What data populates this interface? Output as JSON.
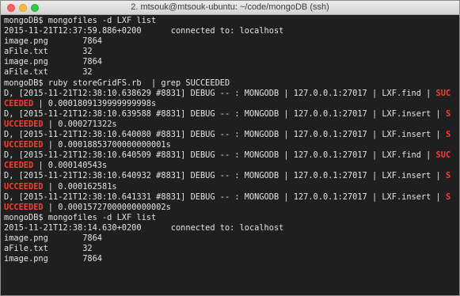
{
  "window": {
    "title": "2. mtsouk@mtsouk-ubuntu: ~/code/mongoDB (ssh)"
  },
  "colors": {
    "background": "#1f1f1f",
    "text": "#e4e4e4",
    "grep_highlight": "#ff3b30"
  },
  "terminal": {
    "lines": [
      {
        "segments": [
          {
            "text": "mongoDB$ mongofiles -d LXF list",
            "hl": false
          }
        ]
      },
      {
        "segments": [
          {
            "text": "2015-11-21T12:37:59.886+0200      connected to: localhost",
            "hl": false
          }
        ]
      },
      {
        "segments": [
          {
            "text": "image.png       7864",
            "hl": false
          }
        ]
      },
      {
        "segments": [
          {
            "text": "aFile.txt       32",
            "hl": false
          }
        ]
      },
      {
        "segments": [
          {
            "text": "image.png       7864",
            "hl": false
          }
        ]
      },
      {
        "segments": [
          {
            "text": "aFile.txt       32",
            "hl": false
          }
        ]
      },
      {
        "segments": [
          {
            "text": "mongoDB$ ruby storeGridFS.rb  | grep SUCCEEDED",
            "hl": false
          }
        ]
      },
      {
        "segments": [
          {
            "text": "D, [2015-11-21T12:38:10.638629 #8831] DEBUG -- : MONGODB | 127.0.0.1:27017 | LXF.find | ",
            "hl": false
          },
          {
            "text": "SUC",
            "hl": true
          }
        ]
      },
      {
        "segments": [
          {
            "text": "CEEDED",
            "hl": true
          },
          {
            "text": " | 0.0001809139999999998s",
            "hl": false
          }
        ]
      },
      {
        "segments": [
          {
            "text": "D, [2015-11-21T12:38:10.639588 #8831] DEBUG -- : MONGODB | 127.0.0.1:27017 | LXF.insert | ",
            "hl": false
          },
          {
            "text": "S",
            "hl": true
          }
        ]
      },
      {
        "segments": [
          {
            "text": "UCCEEDED",
            "hl": true
          },
          {
            "text": " | 0.000271322s",
            "hl": false
          }
        ]
      },
      {
        "segments": [
          {
            "text": "D, [2015-11-21T12:38:10.640080 #8831] DEBUG -- : MONGODB | 127.0.0.1:27017 | LXF.insert | ",
            "hl": false
          },
          {
            "text": "S",
            "hl": true
          }
        ]
      },
      {
        "segments": [
          {
            "text": "UCCEEDED",
            "hl": true
          },
          {
            "text": " | 0.00018853700000000001s",
            "hl": false
          }
        ]
      },
      {
        "segments": [
          {
            "text": "D, [2015-11-21T12:38:10.640509 #8831] DEBUG -- : MONGODB | 127.0.0.1:27017 | LXF.find | ",
            "hl": false
          },
          {
            "text": "SUC",
            "hl": true
          }
        ]
      },
      {
        "segments": [
          {
            "text": "CEEDED",
            "hl": true
          },
          {
            "text": " | 0.000140543s",
            "hl": false
          }
        ]
      },
      {
        "segments": [
          {
            "text": "D, [2015-11-21T12:38:10.640932 #8831] DEBUG -- : MONGODB | 127.0.0.1:27017 | LXF.insert | ",
            "hl": false
          },
          {
            "text": "S",
            "hl": true
          }
        ]
      },
      {
        "segments": [
          {
            "text": "UCCEEDED",
            "hl": true
          },
          {
            "text": " | 0.000162581s",
            "hl": false
          }
        ]
      },
      {
        "segments": [
          {
            "text": "D, [2015-11-21T12:38:10.641331 #8831] DEBUG -- : MONGODB | 127.0.0.1:27017 | LXF.insert | ",
            "hl": false
          },
          {
            "text": "S",
            "hl": true
          }
        ]
      },
      {
        "segments": [
          {
            "text": "UCCEEDED",
            "hl": true
          },
          {
            "text": " | 0.00015727000000000002s",
            "hl": false
          }
        ]
      },
      {
        "segments": [
          {
            "text": "mongoDB$ mongofiles -d LXF list",
            "hl": false
          }
        ]
      },
      {
        "segments": [
          {
            "text": "2015-11-21T12:38:14.630+0200      connected to: localhost",
            "hl": false
          }
        ]
      },
      {
        "segments": [
          {
            "text": "image.png       7864",
            "hl": false
          }
        ]
      },
      {
        "segments": [
          {
            "text": "aFile.txt       32",
            "hl": false
          }
        ]
      },
      {
        "segments": [
          {
            "text": "image.png       7864",
            "hl": false
          }
        ]
      }
    ]
  }
}
